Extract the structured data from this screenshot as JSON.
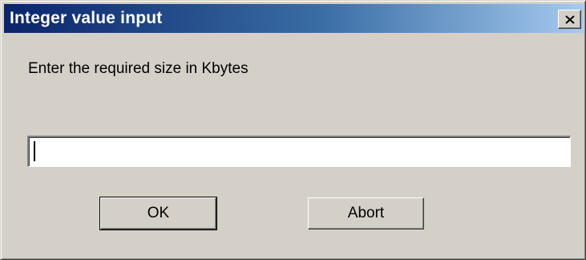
{
  "window": {
    "title": "Integer value input"
  },
  "dialog": {
    "prompt": "Enter the required size in Kbytes",
    "input": {
      "value": "",
      "placeholder": ""
    },
    "buttons": {
      "ok_label": "OK",
      "abort_label": "Abort"
    }
  },
  "icons": {
    "close": "close-icon"
  }
}
